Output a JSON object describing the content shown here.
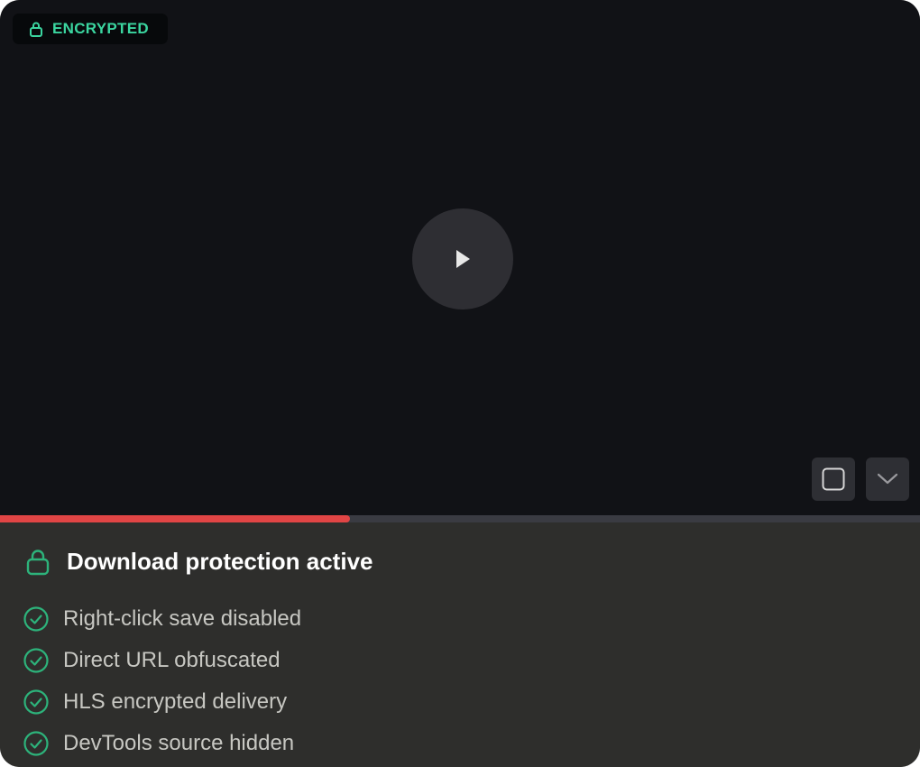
{
  "badge": {
    "label": "ENCRYPTED",
    "icon": "lock-icon"
  },
  "player": {
    "play_icon": "play-icon",
    "progress": 0.38,
    "controls": [
      {
        "name": "stop-button",
        "icon": "square-icon"
      },
      {
        "name": "expand-button",
        "icon": "chevron-down-icon"
      }
    ]
  },
  "protection": {
    "title": "Download protection active",
    "icon": "lock-icon",
    "items": [
      {
        "label": "Right-click save disabled"
      },
      {
        "label": "Direct URL obfuscated"
      },
      {
        "label": "HLS encrypted delivery"
      },
      {
        "label": "DevTools source hidden"
      }
    ]
  },
  "colors": {
    "accent_green": "#3bd6a0",
    "check_green": "#2db37b",
    "progress_red": "#e14545",
    "video_bg": "#111216",
    "panel_bg": "#2e2e2c"
  }
}
